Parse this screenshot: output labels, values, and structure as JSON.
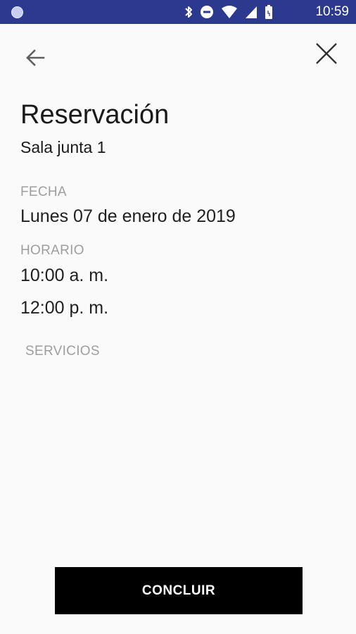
{
  "status_bar": {
    "time": "10:59",
    "icons": [
      "app-indicator-icon",
      "bluetooth-icon",
      "do-not-disturb-icon",
      "wifi-icon",
      "signal-icon",
      "battery-icon"
    ],
    "background_color": "#2b3a8f"
  },
  "app_bar": {
    "back_icon": "arrow-left-icon",
    "close_icon": "close-icon"
  },
  "reservation": {
    "title": "Reservación",
    "room": "Sala junta 1",
    "date_label": "FECHA",
    "date_value": "Lunes 07 de enero de 2019",
    "time_label": "HORARIO",
    "start_time": "10:00 a. m.",
    "end_time": "12:00 p. m.",
    "services_label": "SERVICIOS"
  },
  "actions": {
    "conclude_label": "CONCLUIR"
  },
  "colors": {
    "background": "#fafafa",
    "primary_text": "#1a1a1a",
    "secondary_text": "#9e9e9e",
    "button_bg": "#000000",
    "button_text": "#ffffff"
  }
}
